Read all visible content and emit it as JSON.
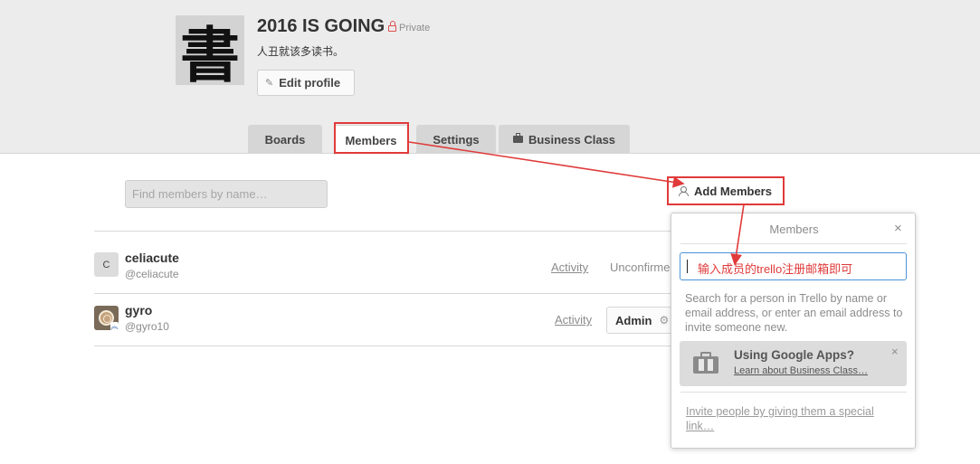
{
  "org": {
    "title": "2016 IS GOING",
    "visibility": "Private",
    "description": "人丑就该多读书。",
    "avatar_glyph": "書",
    "edit_profile_label": "Edit profile"
  },
  "tabs": [
    {
      "label": "Boards",
      "active": false
    },
    {
      "label": "Members",
      "active": true
    },
    {
      "label": "Settings",
      "active": false
    },
    {
      "label": "Business Class",
      "active": false,
      "icon": "briefcase-icon"
    }
  ],
  "members_page": {
    "search_placeholder": "Find members by name…",
    "add_members_label": "Add Members"
  },
  "members": [
    {
      "initial": "C",
      "name": "celiacute",
      "username": "@celiacute",
      "activity_label": "Activity",
      "status": "Unconfirmed"
    },
    {
      "name": "gyro",
      "username": "@gyro10",
      "activity_label": "Activity",
      "role": "Admin"
    }
  ],
  "popover": {
    "title": "Members",
    "close": "×",
    "input_annotation": "输入成员的trello注册邮箱即可",
    "help_text": "Search for a person in Trello by name or email address, or enter an email address to invite someone new.",
    "google_apps": {
      "title": "Using Google Apps?",
      "link": "Learn about Business Class…",
      "close": "×"
    },
    "invite_link": "Invite people by giving them a special link…"
  },
  "colors": {
    "annotation_red": "#e03a3a",
    "header_bg": "#ececec",
    "input_focus_blue": "#4b93d8"
  }
}
